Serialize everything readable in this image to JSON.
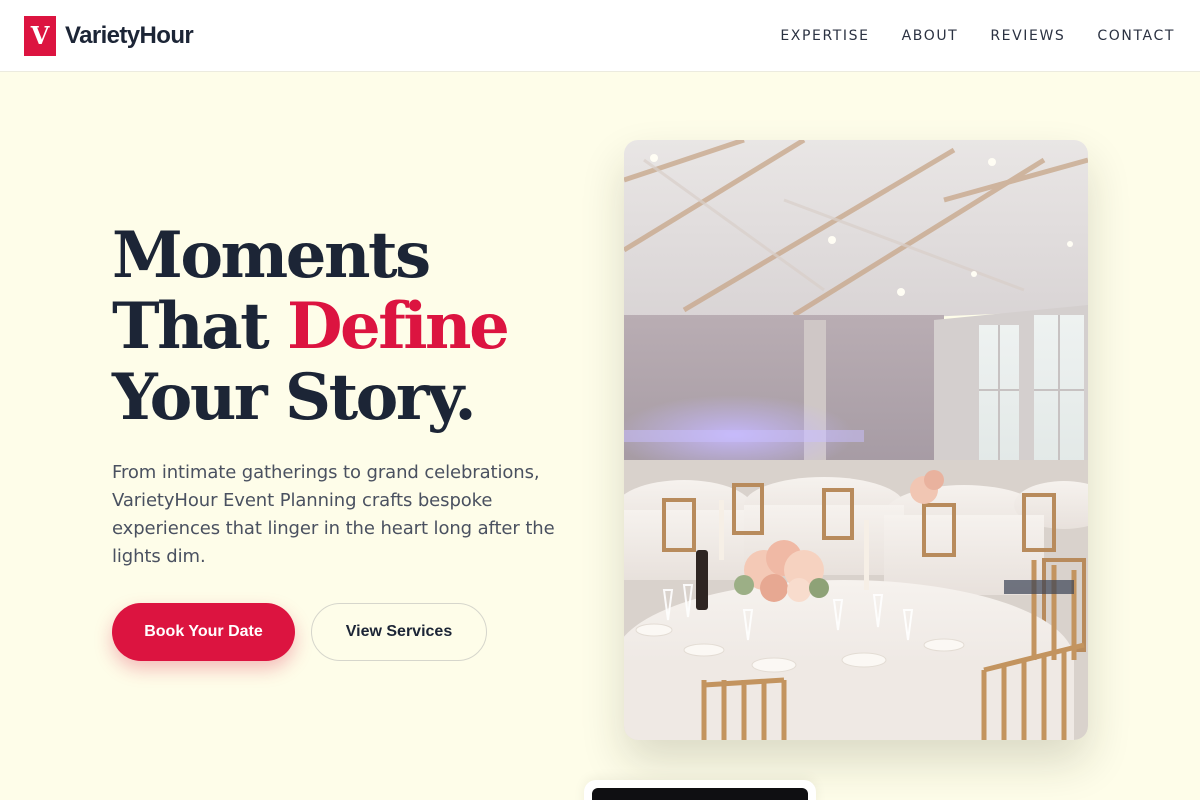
{
  "brand": {
    "logo_letter": "V",
    "name": "VarietyHour",
    "accent_color": "#dc1440"
  },
  "nav": {
    "items": [
      "EXPERTISE",
      "ABOUT",
      "REVIEWS",
      "CONTACT"
    ]
  },
  "hero": {
    "title_line1": "Moments",
    "title_line2_a": "That ",
    "title_line2_b": "Define",
    "title_line3": "Your Story.",
    "description": "From intimate gatherings to grand celebrations, VarietyHour Event Planning crafts bespoke experiences that linger in the heart long after the lights dim.",
    "primary_button": "Book Your Date",
    "secondary_button": "View Services",
    "image_subject": "banquet-hall-photo"
  },
  "colors": {
    "background": "#fefde9",
    "text": "#1c2536",
    "accent": "#dc1440"
  }
}
